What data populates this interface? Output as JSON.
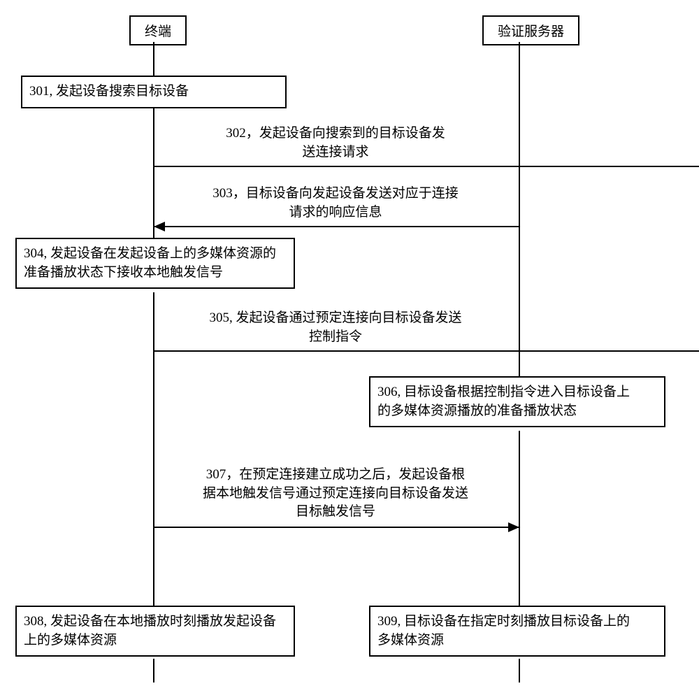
{
  "lanes": {
    "left_title": "终端",
    "right_title": "验证服务器"
  },
  "steps": {
    "s301": "301, 发起设备搜索目标设备",
    "s302": "302，发起设备向搜索到的目标设备发\n送连接请求",
    "s303": "303，目标设备向发起设备发送对应于连接\n请求的响应信息",
    "s304": "304, 发起设备在发起设备上的多媒体资源的\n准备播放状态下接收本地触发信号",
    "s305": "305, 发起设备通过预定连接向目标设备发送\n控制指令",
    "s306": "306, 目标设备根据控制指令进入目标设备上\n的多媒体资源播放的准备播放状态",
    "s307": "307，在预定连接建立成功之后，发起设备根\n据本地触发信号通过预定连接向目标设备发送\n目标触发信号",
    "s308": "308, 发起设备在本地播放时刻播放发起设备\n上的多媒体资源",
    "s309": "309, 目标设备在指定时刻播放目标设备上的\n多媒体资源"
  }
}
